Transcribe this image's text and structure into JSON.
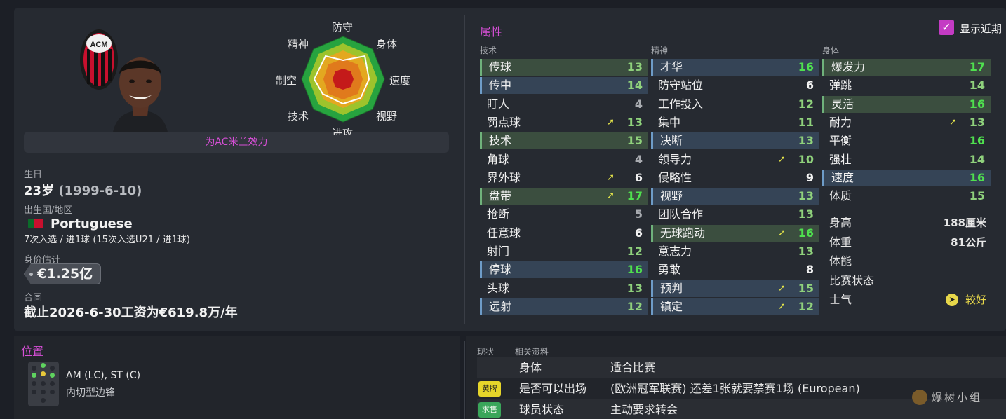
{
  "profile": {
    "plays_for": "为AC米兰效力",
    "dob_label": "生日",
    "age": "23岁",
    "dob": "(1999-6-10)",
    "nationality_label": "出生国/地区",
    "nationality": "Portuguese",
    "caps": "7次入选 / 进1球 (15次入选U21 / 进1球)",
    "value_label": "身价估计",
    "value": "€1.25亿",
    "contract_label": "合同",
    "contract": "截止2026-6-30工资为€619.8万/年",
    "club_badge_text": "ACM"
  },
  "radar": {
    "labels": [
      "防守",
      "身体",
      "速度",
      "视野",
      "进攻",
      "技术",
      "制空",
      "精神"
    ]
  },
  "attributes": {
    "title": "属性",
    "show_recent_label": "显示近期",
    "technical_header": "技术",
    "mental_header": "精神",
    "physical_header": "身体",
    "technical": [
      {
        "name": "传球",
        "value": "13",
        "hl": "green",
        "arrow": false,
        "color": "lgreen"
      },
      {
        "name": "传中",
        "value": "14",
        "hl": "blue",
        "arrow": false,
        "color": "lgreen"
      },
      {
        "name": "盯人",
        "value": "4",
        "hl": "",
        "arrow": false,
        "color": "grey"
      },
      {
        "name": "罚点球",
        "value": "13",
        "hl": "",
        "arrow": true,
        "color": "lgreen"
      },
      {
        "name": "技术",
        "value": "15",
        "hl": "green",
        "arrow": false,
        "color": "lgreen"
      },
      {
        "name": "角球",
        "value": "4",
        "hl": "",
        "arrow": false,
        "color": "grey"
      },
      {
        "name": "界外球",
        "value": "6",
        "hl": "",
        "arrow": true,
        "color": "white"
      },
      {
        "name": "盘带",
        "value": "17",
        "hl": "green",
        "arrow": true,
        "color": "green"
      },
      {
        "name": "抢断",
        "value": "5",
        "hl": "",
        "arrow": false,
        "color": "grey"
      },
      {
        "name": "任意球",
        "value": "6",
        "hl": "",
        "arrow": false,
        "color": "white"
      },
      {
        "name": "射门",
        "value": "12",
        "hl": "",
        "arrow": false,
        "color": "lgreen"
      },
      {
        "name": "停球",
        "value": "16",
        "hl": "blue",
        "arrow": false,
        "color": "green"
      },
      {
        "name": "头球",
        "value": "13",
        "hl": "",
        "arrow": false,
        "color": "lgreen"
      },
      {
        "name": "远射",
        "value": "12",
        "hl": "blue",
        "arrow": false,
        "color": "lgreen"
      }
    ],
    "mental": [
      {
        "name": "才华",
        "value": "16",
        "hl": "blue",
        "arrow": false,
        "color": "green"
      },
      {
        "name": "防守站位",
        "value": "6",
        "hl": "",
        "arrow": false,
        "color": "white"
      },
      {
        "name": "工作投入",
        "value": "12",
        "hl": "",
        "arrow": false,
        "color": "lgreen"
      },
      {
        "name": "集中",
        "value": "11",
        "hl": "",
        "arrow": false,
        "color": "lgreen"
      },
      {
        "name": "决断",
        "value": "13",
        "hl": "blue",
        "arrow": false,
        "color": "lgreen"
      },
      {
        "name": "领导力",
        "value": "10",
        "hl": "",
        "arrow": true,
        "color": "lgreen"
      },
      {
        "name": "侵略性",
        "value": "9",
        "hl": "",
        "arrow": false,
        "color": "white"
      },
      {
        "name": "视野",
        "value": "13",
        "hl": "blue",
        "arrow": false,
        "color": "lgreen"
      },
      {
        "name": "团队合作",
        "value": "13",
        "hl": "",
        "arrow": false,
        "color": "lgreen"
      },
      {
        "name": "无球跑动",
        "value": "16",
        "hl": "green",
        "arrow": true,
        "color": "green"
      },
      {
        "name": "意志力",
        "value": "13",
        "hl": "",
        "arrow": false,
        "color": "lgreen"
      },
      {
        "name": "勇敢",
        "value": "8",
        "hl": "",
        "arrow": false,
        "color": "white"
      },
      {
        "name": "预判",
        "value": "15",
        "hl": "blue",
        "arrow": true,
        "color": "lgreen"
      },
      {
        "name": "镇定",
        "value": "12",
        "hl": "blue",
        "arrow": true,
        "color": "lgreen"
      }
    ],
    "physical": [
      {
        "name": "爆发力",
        "value": "17",
        "hl": "green",
        "arrow": false,
        "color": "green"
      },
      {
        "name": "弹跳",
        "value": "14",
        "hl": "",
        "arrow": false,
        "color": "lgreen"
      },
      {
        "name": "灵活",
        "value": "16",
        "hl": "green",
        "arrow": false,
        "color": "green"
      },
      {
        "name": "耐力",
        "value": "13",
        "hl": "",
        "arrow": true,
        "color": "lgreen"
      },
      {
        "name": "平衡",
        "value": "16",
        "hl": "",
        "arrow": false,
        "color": "green"
      },
      {
        "name": "强壮",
        "value": "14",
        "hl": "",
        "arrow": false,
        "color": "lgreen"
      },
      {
        "name": "速度",
        "value": "16",
        "hl": "blue",
        "arrow": false,
        "color": "green"
      },
      {
        "name": "体质",
        "value": "15",
        "hl": "",
        "arrow": false,
        "color": "lgreen"
      }
    ],
    "physical_info": [
      {
        "name": "身高",
        "value": "188厘米"
      },
      {
        "name": "体重",
        "value": "81公斤"
      },
      {
        "name": "体能",
        "value": ""
      },
      {
        "name": "比赛状态",
        "value": ""
      },
      {
        "name": "士气",
        "value": "较好"
      }
    ]
  },
  "position": {
    "title": "位置",
    "positions": "AM (LC), ST (C)",
    "role": "内切型边锋"
  },
  "status": {
    "col1": "现状",
    "col2": "相关资料",
    "rows": [
      {
        "tag": "",
        "key": "身体",
        "value": "适合比赛"
      },
      {
        "tag": "黄牌",
        "key": "是否可以出场",
        "value": "(欧洲冠军联赛) 还差1张就要禁赛1场 (European)"
      },
      {
        "tag": "求售",
        "key": "球员状态",
        "value": "主动要求转会"
      }
    ]
  },
  "watermark": "爆树小组",
  "colors": {
    "accent": "#d64fd6",
    "green_hi": "#4fe04f",
    "light_green": "#8fd17c",
    "arrow": "#e7e74a"
  }
}
